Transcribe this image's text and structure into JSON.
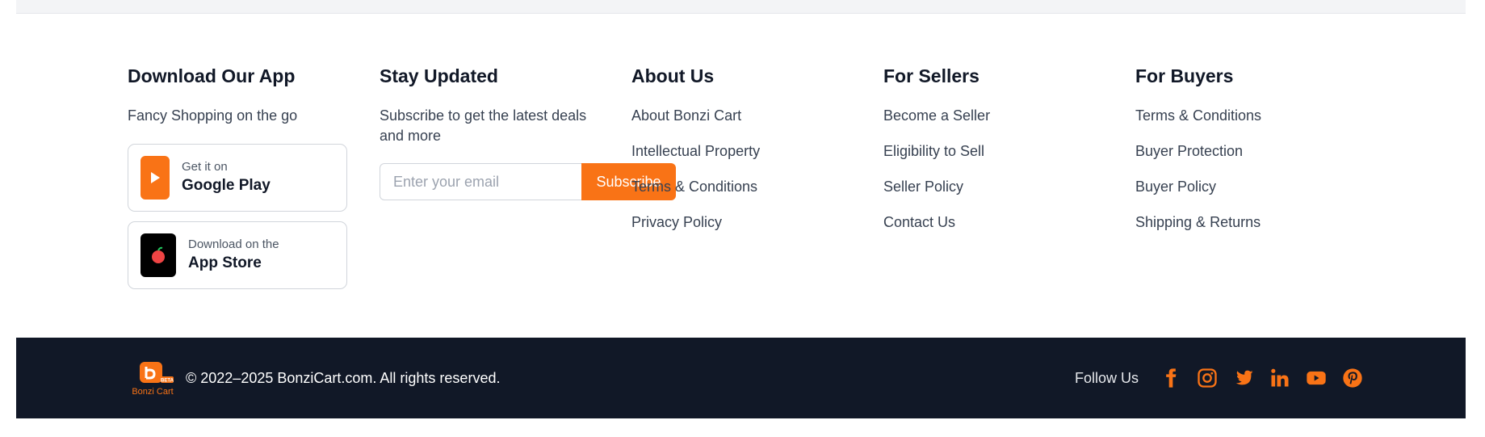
{
  "download_app": {
    "title": "Download Our App",
    "subtitle": "Fancy Shopping on the go",
    "google_play": {
      "small": "Get it on",
      "big": "Google Play"
    },
    "app_store": {
      "small": "Download on the",
      "big": "App Store"
    }
  },
  "stay_updated": {
    "title": "Stay Updated",
    "description": "Subscribe to get the latest deals and more",
    "email_placeholder": "Enter your email",
    "subscribe_label": "Subscribe"
  },
  "about_us": {
    "title": "About Us",
    "links": [
      "About Bonzi Cart",
      "Intellectual Property",
      "Terms & Conditions",
      "Privacy Policy"
    ]
  },
  "for_sellers": {
    "title": "For Sellers",
    "links": [
      "Become a Seller",
      "Eligibility to Sell",
      "Seller Policy",
      "Contact Us"
    ]
  },
  "for_buyers": {
    "title": "For Buyers",
    "links": [
      "Terms & Conditions",
      "Buyer Protection",
      "Buyer Policy",
      "Shipping & Returns"
    ]
  },
  "bottom_bar": {
    "logo_text": "Bonzi Cart",
    "logo_badge": "BETA",
    "copyright": "© 2022–2025 BonziCart.com. All rights reserved.",
    "follow_label": "Follow Us",
    "social_icons": [
      "facebook-icon",
      "instagram-icon",
      "twitter-icon",
      "linkedin-icon",
      "youtube-icon",
      "pinterest-icon"
    ]
  },
  "colors": {
    "accent": "#f97316",
    "dark_bar": "#111827",
    "text": "#374151"
  }
}
